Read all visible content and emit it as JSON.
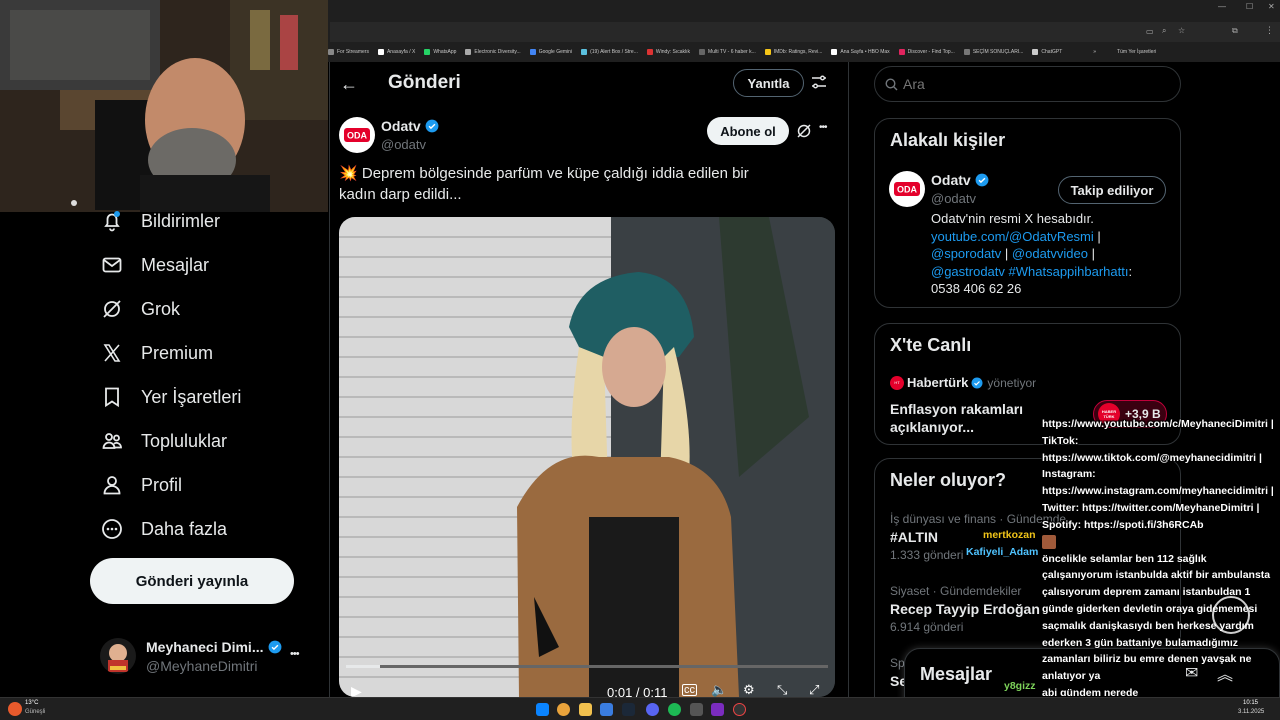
{
  "browser": {
    "bookmarks": [
      "For Streamers",
      "Anasayfa / X",
      "WhatsApp",
      "Electronic Diversity...",
      "Google Gemini",
      "(19) Alert Box / Stre...",
      "Windy: Sıcaklık",
      "Multi TV - 6 haber k...",
      "IMDb: Ratings, Revi...",
      "Ana Sayfa • HBO Max",
      "Discover - Find Top...",
      "SEÇİM SONUÇLARI...",
      "ChatGPT"
    ],
    "all_bookmarks": "Tüm Yer İşaretleri",
    "more_bookmarks": "»"
  },
  "nav": {
    "items": [
      {
        "label": "Bildirimler",
        "icon": "bell-icon"
      },
      {
        "label": "Mesajlar",
        "icon": "envelope-icon"
      },
      {
        "label": "Grok",
        "icon": "grok-icon"
      },
      {
        "label": "Premium",
        "icon": "x-logo-icon"
      },
      {
        "label": "Yer İşaretleri",
        "icon": "bookmark-icon"
      },
      {
        "label": "Topluluklar",
        "icon": "people-icon"
      },
      {
        "label": "Profil",
        "icon": "person-icon"
      },
      {
        "label": "Daha fazla",
        "icon": "more-circle-icon"
      }
    ],
    "post_button": "Gönderi yayınla",
    "account": {
      "name": "Meyhaneci Dimi...",
      "handle": "@MeyhaneDimitri",
      "more": "•••"
    }
  },
  "post": {
    "header_title": "Gönderi",
    "reply_button": "Yanıtla",
    "author_name": "Odatv",
    "author_handle": "@odatv",
    "subscribe_button": "Abone ol",
    "more": "•••",
    "text_emoji": "💥",
    "text": "Deprem bölgesinde parfüm ve küpe çaldığı iddia edilen bir kadın darp edildi...",
    "video": {
      "time": "0:01 / 0:11",
      "progress": 0.07
    }
  },
  "search": {
    "placeholder": "Ara"
  },
  "related": {
    "title": "Alakalı kişiler",
    "name": "Odatv",
    "handle": "@odatv",
    "follow_button": "Takip ediliyor",
    "bio_text": "Odatv'nin resmi X hesabıdır.",
    "link1": "youtube.com/@OdatvResmi",
    "sep1": " |",
    "mention1": "@sporodatv",
    "sep2": " | ",
    "mention2": "@odatvvideo",
    "sep3": " |",
    "mention3": "@gastrodatv",
    "hashtag": " #Whatsappihbarhattı",
    "phone_prefix": ":",
    "phone": "0538 406 62 26"
  },
  "live": {
    "title": "X'te Canlı",
    "host": "Habertürk",
    "host_role": "yönetiyor",
    "topic": "Enflasyon rakamları açıklanıyor...",
    "listeners": "+3,9 B",
    "badge": "HABER TÜRK"
  },
  "trends": {
    "title": "Neler oluyor?",
    "items": [
      {
        "context": "İş dünyası ve finans · Gündemde",
        "name": "#ALTIN",
        "count": "1.333 gönderi"
      },
      {
        "context": "Siyaset · Gündemdekiler",
        "name": "Recep Tayyip Erdoğan",
        "count": "6.914 gönderi"
      },
      {
        "context": "Spo",
        "name": "Se",
        "count": ""
      }
    ]
  },
  "messages_drawer": {
    "title": "Mesajlar"
  },
  "chat": {
    "lines": [
      {
        "text": "https://www.youtube.com/c/MeyhaneciDimitri |"
      },
      {
        "text": "TikTok:"
      },
      {
        "text": "https://www.tiktok.com/@meyhanecidimitri |"
      },
      {
        "text": "Instagram:"
      },
      {
        "text": "https://www.instagram.com/meyhanecidimitri |"
      },
      {
        "text": "Twitter: https://twitter.com/MeyhaneDimitri |"
      },
      {
        "text": "Spotify: https://spoti.fi/3h6RCAb"
      }
    ],
    "usernames": [
      "mertkozan",
      "Kafiyeli_Adam",
      "y8gizz"
    ],
    "message": "öncelikle selamlar ben 112 sağlık çalışanıyorum istanbulda aktif bir ambulansta çalısıyorum deprem zamanı istanbuldan 1 günde giderken devletin oraya gidememesi saçmalık danişkasıydı ben herkese yardım ederken 3 gün battaniye bulamadığımız zamanları biliriz bu emre denen yavşak ne anlatıyor ya",
    "last": "abi gündem nerede"
  },
  "taskbar": {
    "weather_temp": "13°C",
    "weather_desc": "Güneşli",
    "time": "10:15",
    "date": "3.11.2025"
  },
  "colors": {
    "accent": "#1d9bf0",
    "bg": "#000000",
    "border": "#2f3336",
    "muted": "#71767b",
    "odatv_red": "#e4002b"
  }
}
